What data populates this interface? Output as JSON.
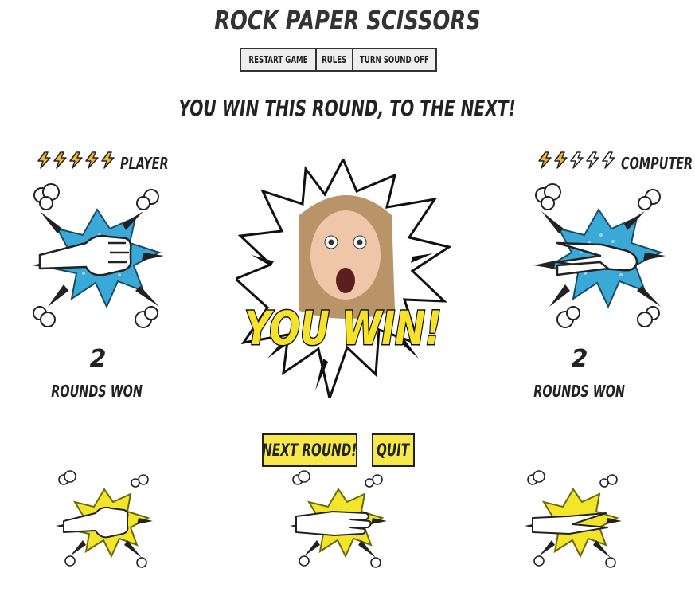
{
  "title": "ROCK PAPER SCISSORS",
  "toolbar": {
    "restart_label": "RESTART GAME",
    "rules_label": "RULES",
    "sound_label": "TURN SOUND OFF"
  },
  "message": "YOU WIN THIS ROUND, TO THE NEXT!",
  "player": {
    "label": "PLAYER",
    "lives_filled": 5,
    "lives_total": 5,
    "score": "2",
    "score_label": "ROUNDS WON",
    "choice": "rock"
  },
  "computer": {
    "label": "COMPUTER",
    "lives_filled": 2,
    "lives_total": 5,
    "score": "2",
    "score_label": "ROUNDS WON",
    "choice": "scissors"
  },
  "result": {
    "banner": "YOU WIN!"
  },
  "actions": {
    "next_label": "NEXT ROUND!",
    "quit_label": "QUIT"
  },
  "choices": [
    "rock",
    "paper",
    "scissors"
  ],
  "colors": {
    "bolt_fill": "#f2b632",
    "burst_blue": "#3aa9d8",
    "burst_yellow": "#f2e52a",
    "button_yellow": "#f7e94a",
    "banner_yellow": "#f7e22a"
  }
}
